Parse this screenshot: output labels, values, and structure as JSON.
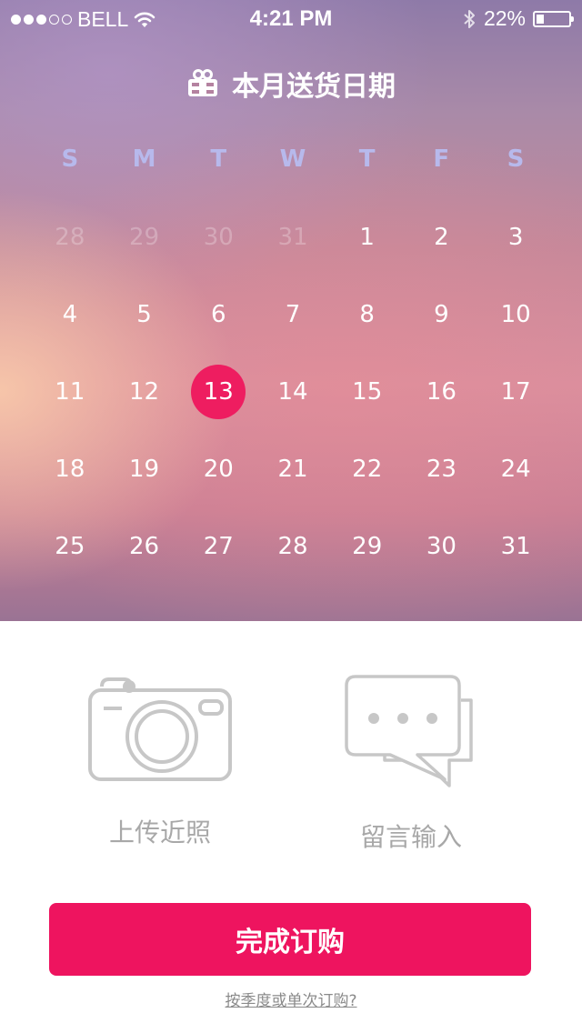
{
  "status_bar": {
    "carrier": "BELL",
    "time": "4:21 PM",
    "battery": "22%",
    "signal_icon": "signal-dots-icon",
    "wifi_icon": "wifi-icon",
    "bluetooth_icon": "bluetooth-icon",
    "battery_icon": "battery-icon"
  },
  "header": {
    "title": "本月送货日期",
    "icon": "gift-icon"
  },
  "calendar": {
    "weekdays": [
      "S",
      "M",
      "T",
      "W",
      "T",
      "F",
      "S"
    ],
    "days": [
      {
        "label": "28",
        "dim": true
      },
      {
        "label": "29",
        "dim": true
      },
      {
        "label": "30",
        "dim": true
      },
      {
        "label": "31",
        "dim": true
      },
      {
        "label": "1"
      },
      {
        "label": "2"
      },
      {
        "label": "3"
      },
      {
        "label": "4"
      },
      {
        "label": "5"
      },
      {
        "label": "6"
      },
      {
        "label": "7"
      },
      {
        "label": "8"
      },
      {
        "label": "9"
      },
      {
        "label": "10"
      },
      {
        "label": "11"
      },
      {
        "label": "12"
      },
      {
        "label": "13",
        "selected": true
      },
      {
        "label": "14"
      },
      {
        "label": "15"
      },
      {
        "label": "16"
      },
      {
        "label": "17"
      },
      {
        "label": "18"
      },
      {
        "label": "19"
      },
      {
        "label": "20"
      },
      {
        "label": "21"
      },
      {
        "label": "22"
      },
      {
        "label": "23"
      },
      {
        "label": "24"
      },
      {
        "label": "25"
      },
      {
        "label": "26"
      },
      {
        "label": "27"
      },
      {
        "label": "28"
      },
      {
        "label": "29"
      },
      {
        "label": "30"
      },
      {
        "label": "31"
      }
    ],
    "selected_color": "#ee1d60"
  },
  "actions": {
    "upload_photo": {
      "label": "上传近照",
      "icon": "camera-icon"
    },
    "leave_message": {
      "label": "留言输入",
      "icon": "chat-bubbles-icon"
    }
  },
  "cta": {
    "label": "完成订购",
    "color": "#ee145f"
  },
  "footer_link": "按季度或单次订购?"
}
